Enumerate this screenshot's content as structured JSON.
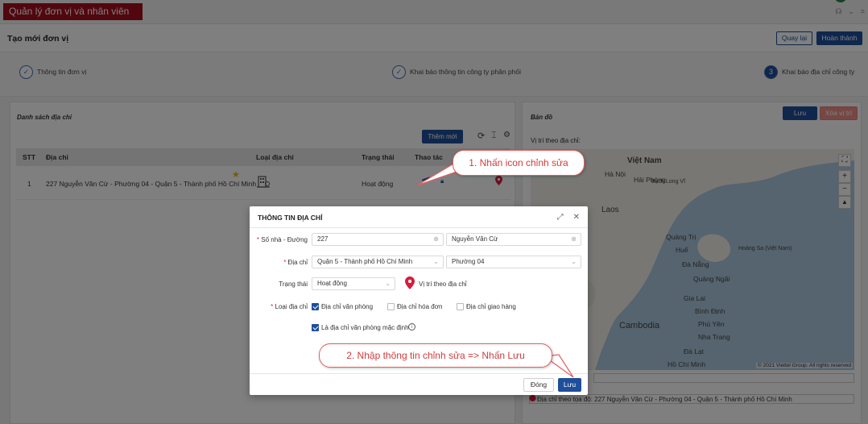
{
  "app": {
    "title": "Quản lý đơn vị và nhân viên"
  },
  "page": {
    "title": "Tạo mới đơn vị",
    "back_label": "Quay lại",
    "finish_label": "Hoàn thành"
  },
  "steps": [
    {
      "label": "Thông tin đơn vị",
      "state": "done",
      "marker": "✓"
    },
    {
      "label": "Khai báo thông tin công ty phân phối",
      "state": "done",
      "marker": "✓"
    },
    {
      "label": "Khai báo địa chỉ công ty",
      "state": "active",
      "marker": "3"
    }
  ],
  "left": {
    "section_title": "Danh sách địa chỉ",
    "add_button": "Thêm mới",
    "columns": [
      "STT",
      "Địa chỉ",
      "Loại địa chỉ",
      "Trạng thái",
      "Thao tác"
    ],
    "rows": [
      {
        "stt": "1",
        "address": "227 Nguyễn Văn Cừ - Phường 04 - Quận 5 - Thành phố Hồ Chí Minh",
        "status": "Hoạt động"
      }
    ]
  },
  "right": {
    "section_title": "Bản đồ",
    "save_label": "Lưu",
    "delete_label": "Xóa vị trí",
    "location_label": "Vị trí theo địa chỉ:",
    "map": {
      "places": [
        "Việt Nam",
        "Hà Nội",
        "Hải Phòng",
        "Bạch Long Vĩ",
        "Laos",
        "Quảng Trị",
        "Huế",
        "Đà Nẵng",
        "Quảng Ngãi",
        "Hoàng Sa (Việt Nam)",
        "Cambodia",
        "Gia Lai",
        "Bình Định",
        "Phú Yên",
        "Nha Trang",
        "Đà Lạt",
        "Hồ Chí Minh"
      ],
      "credit": "© 2021 Viettel Group. All rights reserved"
    },
    "coord_label": "Địa chỉ theo tọa độ: 227 Nguyễn Văn Cừ - Phường 04 - Quận 5 - Thành phố Hồ Chí Minh"
  },
  "modal": {
    "title": "THÔNG TIN ĐỊA CHỈ",
    "street_label": "Số nhà - Đường",
    "street_number": "227",
    "street_name": "Nguyễn Văn Cừ",
    "address_label": "Địa chỉ",
    "district": "Quận 5 - Thành phố Hồ Chí Minh",
    "ward": "Phường 04",
    "status_label": "Trạng thái",
    "status_value": "Hoạt động",
    "location_link": "Vị trí theo địa chỉ",
    "type_label": "Loại địa chỉ",
    "types": [
      {
        "label": "Địa chỉ văn phòng",
        "checked": true
      },
      {
        "label": "Địa chỉ hóa đơn",
        "checked": false
      },
      {
        "label": "Địa chỉ giao hàng",
        "checked": false
      }
    ],
    "default_label": "Là địa chỉ văn phòng mặc định",
    "close_label": "Đóng",
    "save_label": "Lưu"
  },
  "callouts": {
    "first": "1. Nhấn icon chỉnh sửa",
    "second": "2. Nhập thông tin chỉnh sửa => Nhấn Lưu"
  },
  "colors": {
    "brand": "#a50f1d",
    "primary": "#1f4e9b",
    "danger": "#ef8e89",
    "callout": "#d23c3c"
  }
}
